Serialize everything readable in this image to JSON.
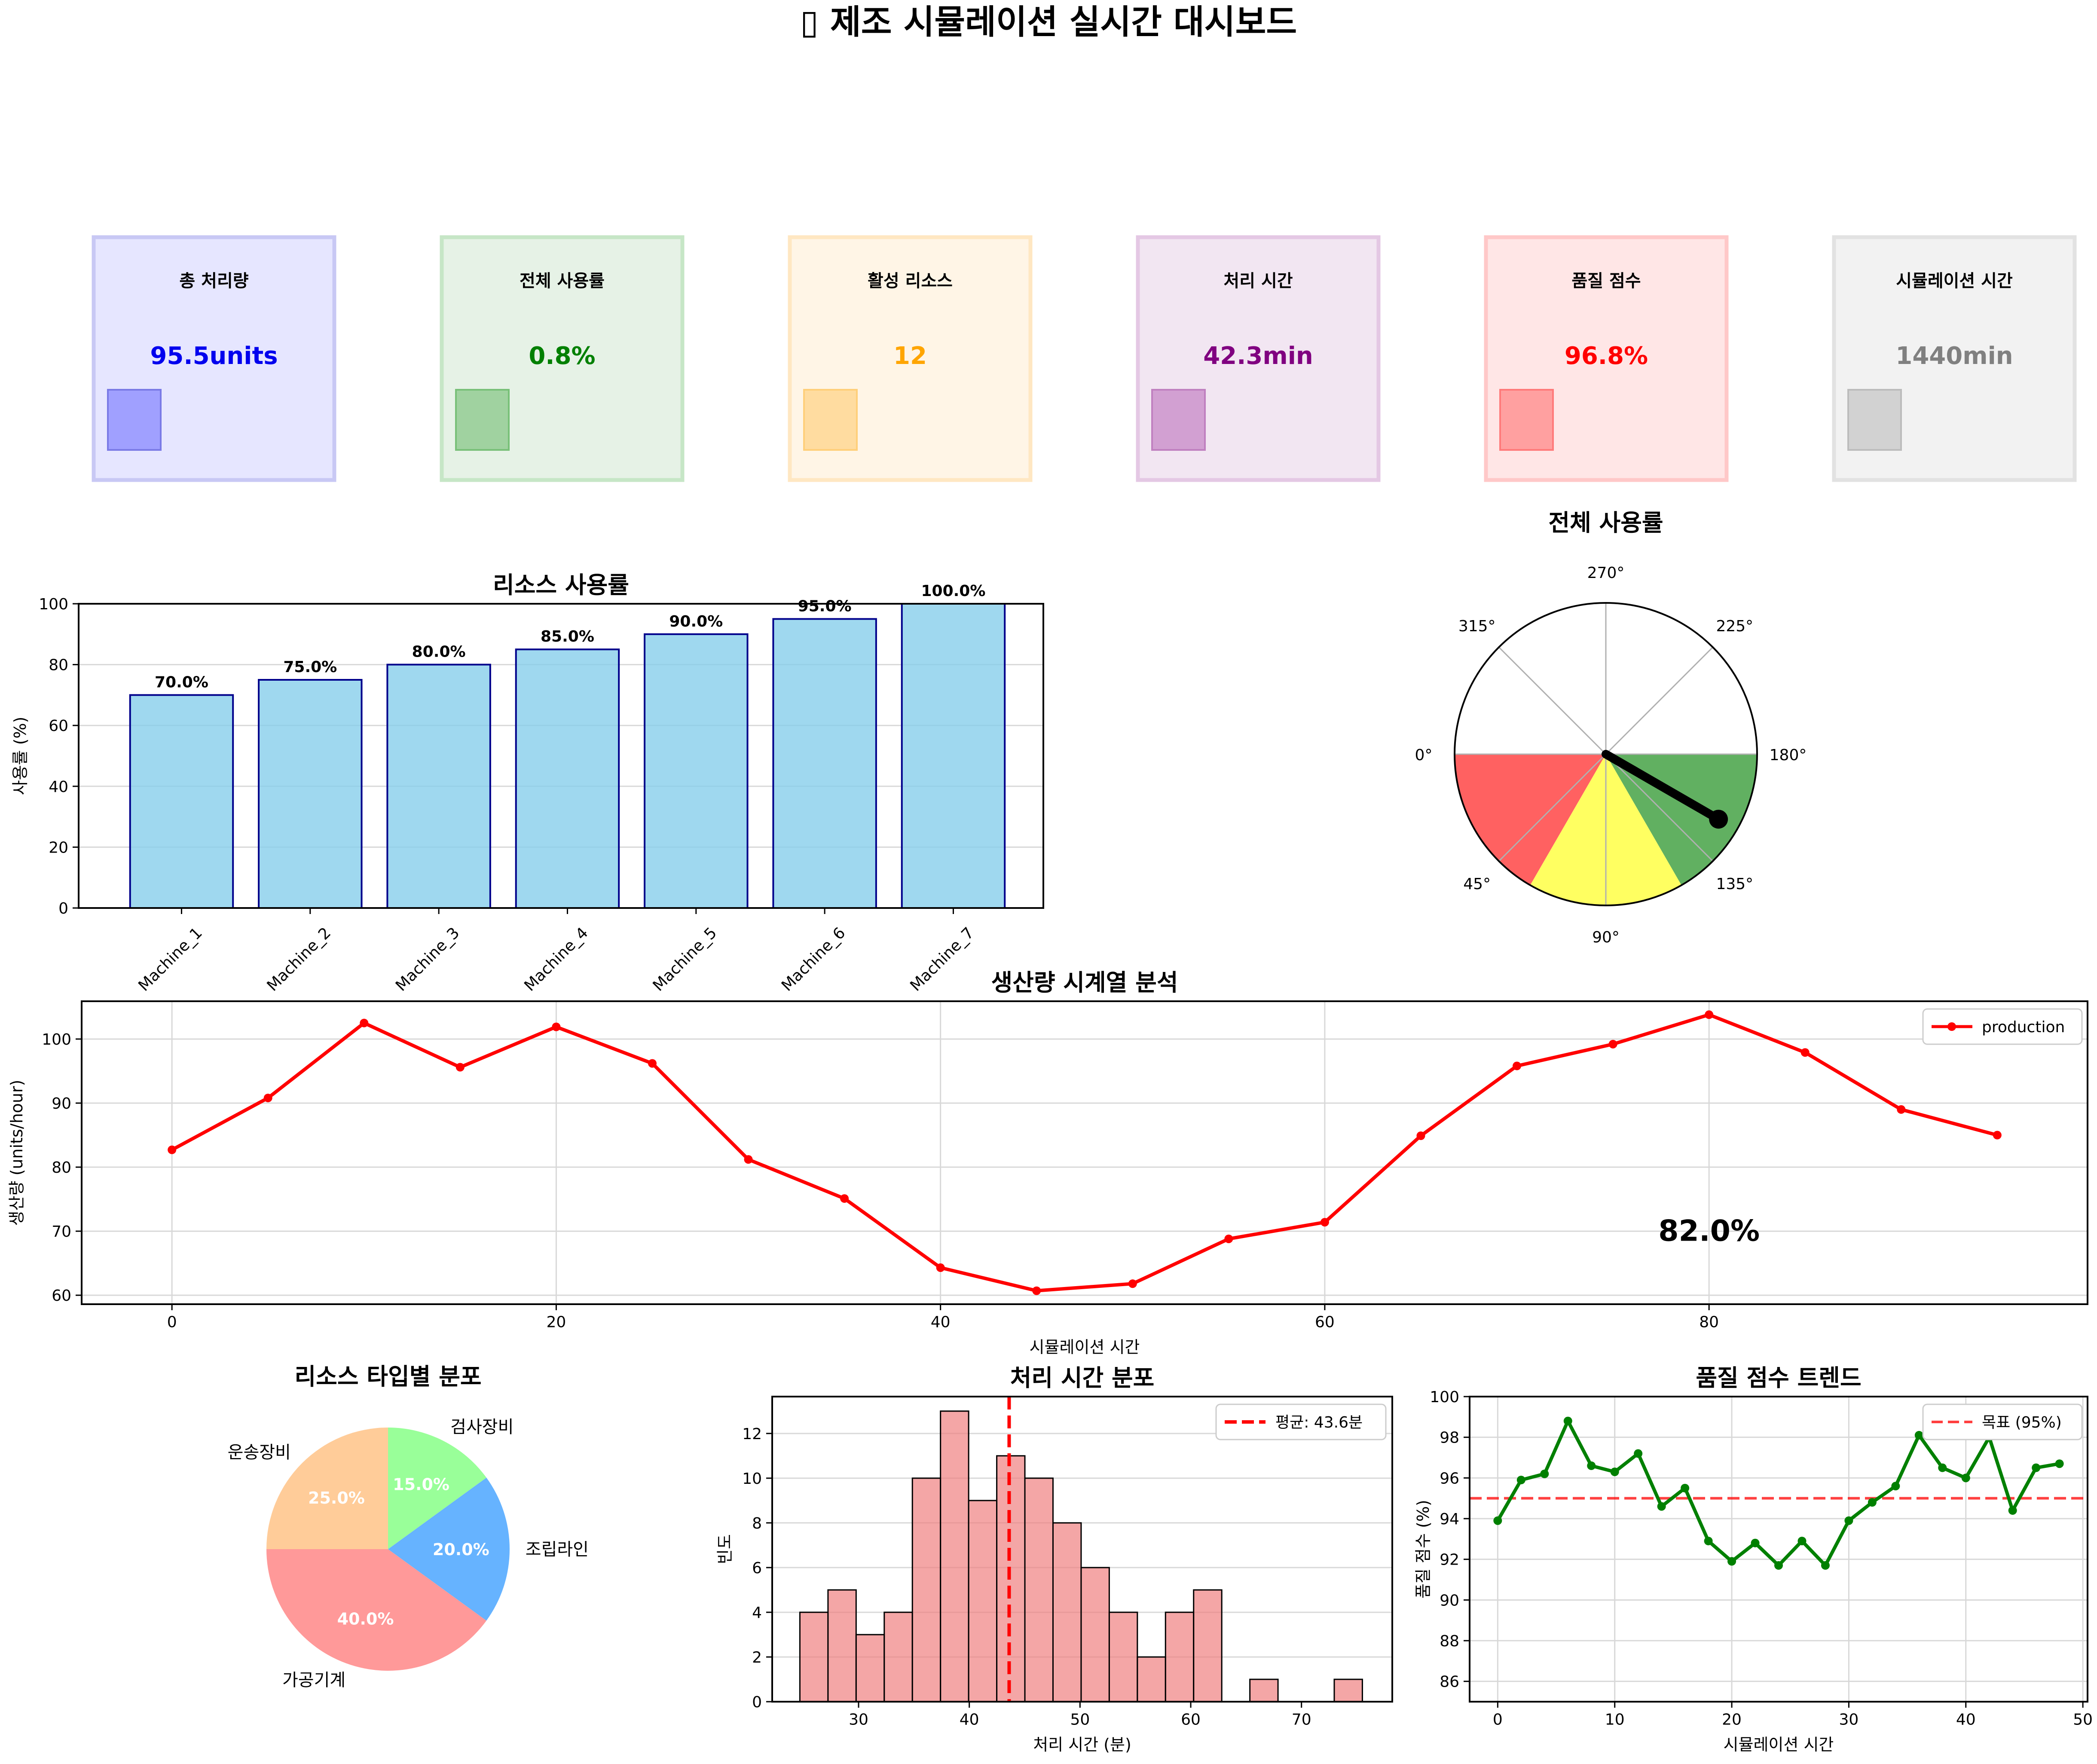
{
  "title": "▯ 제조 시뮬레이션 실시간 대시보드",
  "kpis": [
    {
      "label": "총 처리량",
      "value": "95.5units",
      "color": "#0000ee",
      "bg": "#e6e6ff",
      "border": "#c8c8f4",
      "swatch": "#a0a0ff",
      "swatch_border": "#7a7ae6"
    },
    {
      "label": "전체 사용률",
      "value": "0.8%",
      "color": "#008000",
      "bg": "#e6f2e6",
      "border": "#c6e6c6",
      "swatch": "#a0d2a0",
      "swatch_border": "#78c078"
    },
    {
      "label": "활성 리소스",
      "value": "12",
      "color": "#ffa500",
      "bg": "#fff5e6",
      "border": "#ffe7c2",
      "swatch": "#ffdca0",
      "swatch_border": "#ffcf7a"
    },
    {
      "label": "처리 시간",
      "value": "42.3min",
      "color": "#800080",
      "bg": "#f2e6f2",
      "border": "#e4c8e4",
      "swatch": "#d2a0d2",
      "swatch_border": "#c080c0"
    },
    {
      "label": "품질 점수",
      "value": "96.8%",
      "color": "#ff0000",
      "bg": "#ffe6e6",
      "border": "#ffc8c8",
      "swatch": "#ffa0a0",
      "swatch_border": "#ff7a7a"
    },
    {
      "label": "시뮬레이션 시간",
      "value": "1440min",
      "color": "#808080",
      "bg": "#f2f2f2",
      "border": "#e2e2e2",
      "swatch": "#d2d2d2",
      "swatch_border": "#bcbcbc"
    }
  ],
  "chart_data": [
    {
      "id": "resource_util",
      "type": "bar",
      "title": "리소스 사용률",
      "xlabel": "",
      "ylabel": "사용률 (%)",
      "categories": [
        "Machine_1",
        "Machine_2",
        "Machine_3",
        "Machine_4",
        "Machine_5",
        "Machine_6",
        "Machine_7"
      ],
      "values": [
        70,
        75,
        80,
        85,
        90,
        95,
        100
      ],
      "data_labels": [
        "70.0%",
        "75.0%",
        "80.0%",
        "85.0%",
        "90.0%",
        "95.0%",
        "100.0%"
      ],
      "ylim": [
        0,
        100
      ],
      "yticks": [
        0,
        20,
        40,
        60,
        80,
        100
      ],
      "bar_color": "#87ceeb",
      "edge_color": "#00008b",
      "grid": true
    },
    {
      "id": "overall_gauge",
      "type": "gauge",
      "title": "전체 사용률",
      "angle_labels": [
        "0°",
        "45°",
        "90°",
        "135°",
        "180°",
        "225°",
        "270°",
        "315°"
      ],
      "zones": [
        {
          "from_deg": 0,
          "to_deg": 60,
          "color": "#ff0000"
        },
        {
          "from_deg": 60,
          "to_deg": 120,
          "color": "#ffff00"
        },
        {
          "from_deg": 120,
          "to_deg": 180,
          "color": "#008000"
        }
      ],
      "needle_deg": 150
    },
    {
      "id": "production_ts",
      "type": "line",
      "title": "생산량 시계열 분석",
      "xlabel": "시뮬레이션 시간",
      "ylabel": "생산량 (units/hour)",
      "x": [
        0,
        5,
        10,
        15,
        20,
        25,
        30,
        35,
        40,
        45,
        50,
        55,
        60,
        65,
        70,
        75,
        80,
        85,
        90,
        95
      ],
      "series": [
        {
          "name": "production",
          "color": "#ff0000",
          "values": [
            82.7,
            90.8,
            102.5,
            95.6,
            101.9,
            96.2,
            81.2,
            75.1,
            64.3,
            60.7,
            61.8,
            68.8,
            71.4,
            84.9,
            95.8,
            99.2,
            103.8,
            97.9,
            89.0,
            85.0
          ]
        }
      ],
      "xlim": [
        -4.7,
        99.7
      ],
      "ylim": [
        58.6,
        105.9
      ],
      "xticks": [
        0,
        20,
        40,
        60,
        80
      ],
      "yticks": [
        60,
        70,
        80,
        90,
        100
      ],
      "annotation": {
        "text": "82.0%",
        "x": 80.0,
        "y": 68.5
      },
      "legend": "upper-right",
      "grid": true
    },
    {
      "id": "resource_type_pie",
      "type": "pie",
      "title": "리소스 타입별 분포",
      "slices": [
        {
          "label": "운송장비",
          "value": 25.0,
          "pct": "25.0%",
          "color": "#ffcc99"
        },
        {
          "label": "가공기계",
          "value": 40.0,
          "pct": "40.0%",
          "color": "#ff9999"
        },
        {
          "label": "조립라인",
          "value": 20.0,
          "pct": "20.0%",
          "color": "#66b3ff"
        },
        {
          "label": "검사장비",
          "value": 15.0,
          "pct": "15.0%",
          "color": "#99ff99"
        }
      ],
      "start_angle_deg": 90,
      "direction": "counterclockwise"
    },
    {
      "id": "processing_hist",
      "type": "bar",
      "subtype": "histogram",
      "title": "처리 시간 분포",
      "xlabel": "처리 시간 (분)",
      "ylabel": "빈도",
      "bin_start": 24.7,
      "bin_width": 2.54,
      "counts": [
        4,
        5,
        3,
        4,
        10,
        13,
        9,
        11,
        10,
        8,
        6,
        4,
        2,
        4,
        5,
        0,
        1,
        0,
        0,
        1
      ],
      "mean_line": {
        "value": 43.6,
        "label": "평균: 43.6분"
      },
      "xlim": [
        22.2,
        78.2
      ],
      "ylim": [
        0,
        13.65
      ],
      "xticks": [
        30,
        40,
        50,
        60,
        70
      ],
      "yticks": [
        0,
        2,
        4,
        6,
        8,
        10,
        12
      ],
      "bar_color": "#f08080",
      "grid": true
    },
    {
      "id": "quality_trend",
      "type": "line",
      "title": "품질 점수 트렌드",
      "xlabel": "시뮬레이션 시간",
      "ylabel": "품질 점수 (%)",
      "x": [
        0,
        2,
        4,
        6,
        8,
        10,
        12,
        14,
        16,
        18,
        20,
        22,
        24,
        26,
        28,
        30,
        32,
        34,
        36,
        38,
        40,
        42,
        44,
        46,
        48
      ],
      "series": [
        {
          "name": "",
          "color": "#008000",
          "values": [
            93.9,
            95.9,
            96.2,
            98.8,
            96.6,
            96.3,
            97.2,
            94.6,
            95.5,
            92.9,
            91.9,
            92.8,
            91.7,
            92.9,
            91.7,
            93.9,
            94.8,
            95.6,
            98.1,
            96.5,
            96.0,
            98.0,
            94.4,
            96.5,
            96.7
          ]
        }
      ],
      "target_line": {
        "value": 95,
        "label": "목표 (95%)",
        "color": "#ff0000"
      },
      "xlim": [
        -2.4,
        50.4
      ],
      "ylim": [
        85,
        100
      ],
      "xticks": [
        0,
        10,
        20,
        30,
        40,
        50
      ],
      "yticks": [
        86,
        88,
        90,
        92,
        94,
        96,
        98,
        100
      ],
      "legend": "upper-right",
      "grid": true
    }
  ]
}
